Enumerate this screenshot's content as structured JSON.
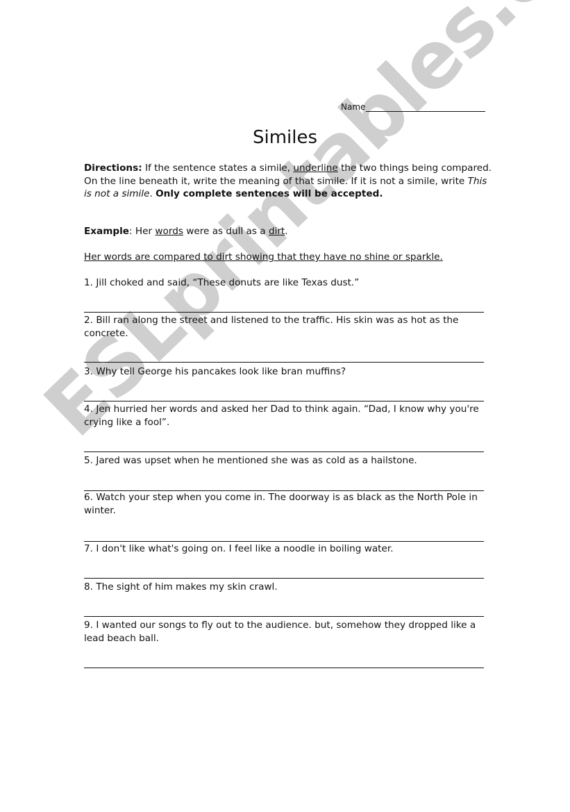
{
  "header": {
    "name_label": "Name"
  },
  "title": "Similes",
  "directions": {
    "label": "Directions:",
    "text_1": " If the sentence states a simile, ",
    "underline_word": "underline",
    "text_2": " the two things being compared. On the line beneath it, write the meaning of that simile. If it is not a simile, write ",
    "italic_phrase": "This is not a simile",
    "text_3": ". ",
    "bold_tail": "Only complete sentences will be accepted."
  },
  "example": {
    "label": "Example",
    "text_1": ": Her ",
    "word_1": "words",
    "text_2": " were as dull as a ",
    "word_2": "dirt",
    "text_3": ".",
    "answer": "Her words are compared to dirt showing that they have no shine or sparkle."
  },
  "questions": [
    {
      "number": "1.",
      "text": "Jill choked and said, “These donuts are like Texas dust.”"
    },
    {
      "number": "2.",
      "text": "Bill ran along the street and listened to the traffic. His skin was as hot as the concrete."
    },
    {
      "number": "3.",
      "text": "Why tell George his pancakes look like bran muffins?"
    },
    {
      "number": "4.",
      "text": "Jen hurried her words and asked her Dad to think again. “Dad, I know why you're crying like a fool”."
    },
    {
      "number": "5.",
      "text": "Jared was upset when he mentioned she was as cold as a hailstone."
    },
    {
      "number": "6.",
      "text": "Watch your step when you come in. The doorway is as black as the North Pole in winter."
    },
    {
      "number": "7.",
      "text": "I don't like what's going on. I feel like a noodle in boiling water."
    },
    {
      "number": "8.",
      "text": "The sight of him makes my skin crawl."
    },
    {
      "number": "9.",
      "text": "I wanted our songs to fly out to the audience. but, somehow they dropped like a lead beach ball."
    }
  ],
  "watermark": "ESLprintables.com"
}
